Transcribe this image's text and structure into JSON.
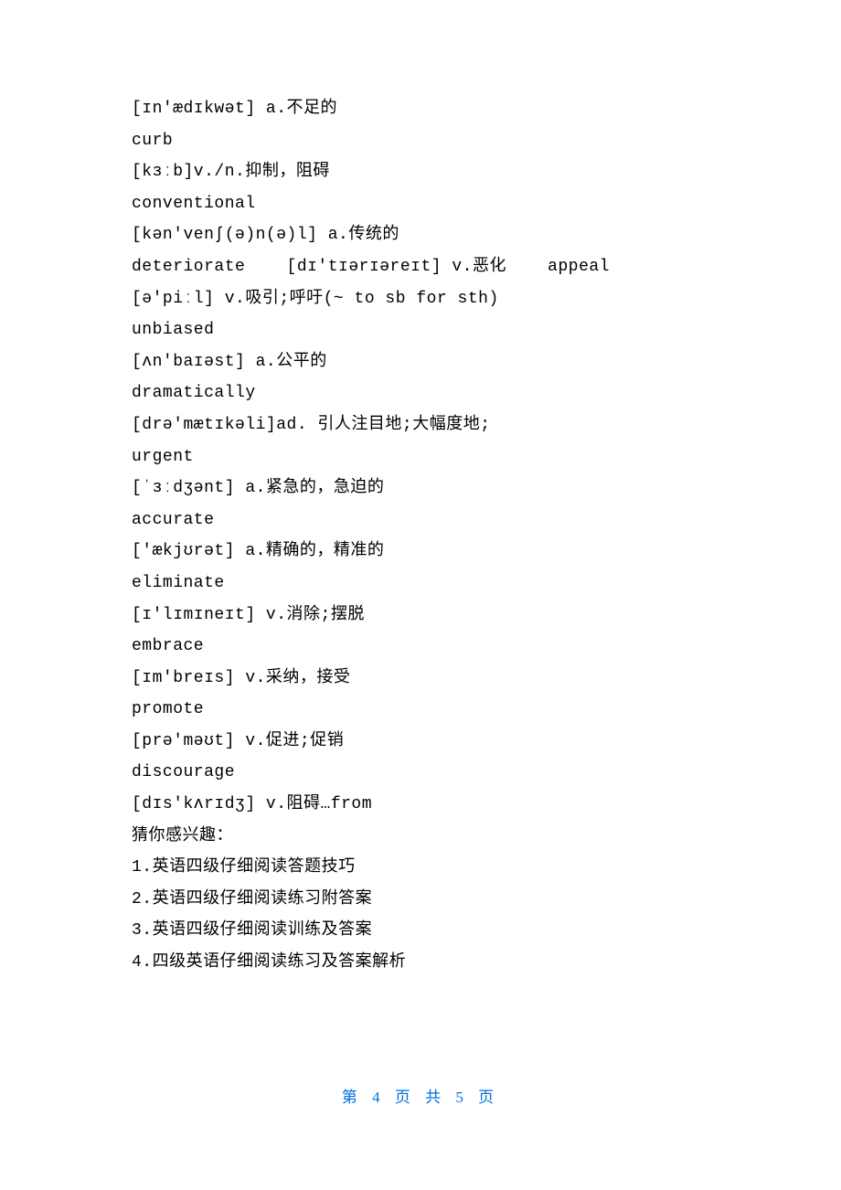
{
  "lines": [
    "[ɪn'ædɪkwət] a.不足的",
    "curb",
    "[kɜːb]v./n.抑制，阻碍",
    "conventional",
    "[kən'venʃ(ə)n(ə)l] a.传统的",
    "deteriorate    [dɪ'tɪərɪəreɪt] v.恶化    appeal",
    "[ə'piːl] v.吸引;呼吁(~ to sb for sth)",
    "unbiased",
    "[ʌn'baɪəst] a.公平的",
    "dramatically",
    "[drə'mætɪkəli]ad. 引人注目地;大幅度地;",
    "urgent",
    "[ˈɜːdʒənt] a.紧急的，急迫的",
    "accurate",
    "['ækjʊrət] a.精确的，精准的",
    "eliminate",
    "[ɪ'lɪmɪneɪt] v.消除;摆脱",
    "embrace",
    "[ɪm'breɪs] v.采纳，接受",
    "promote",
    "[prə'məʊt] v.促进;促销",
    "discourage",
    "[dɪs'kʌrɪdʒ] v.阻碍…from",
    "猜你感兴趣：",
    "1.英语四级仔细阅读答题技巧",
    "2.英语四级仔细阅读练习附答案",
    "3.英语四级仔细阅读训练及答案",
    "4.四级英语仔细阅读练习及答案解析"
  ],
  "footer": "第 4 页 共 5 页"
}
